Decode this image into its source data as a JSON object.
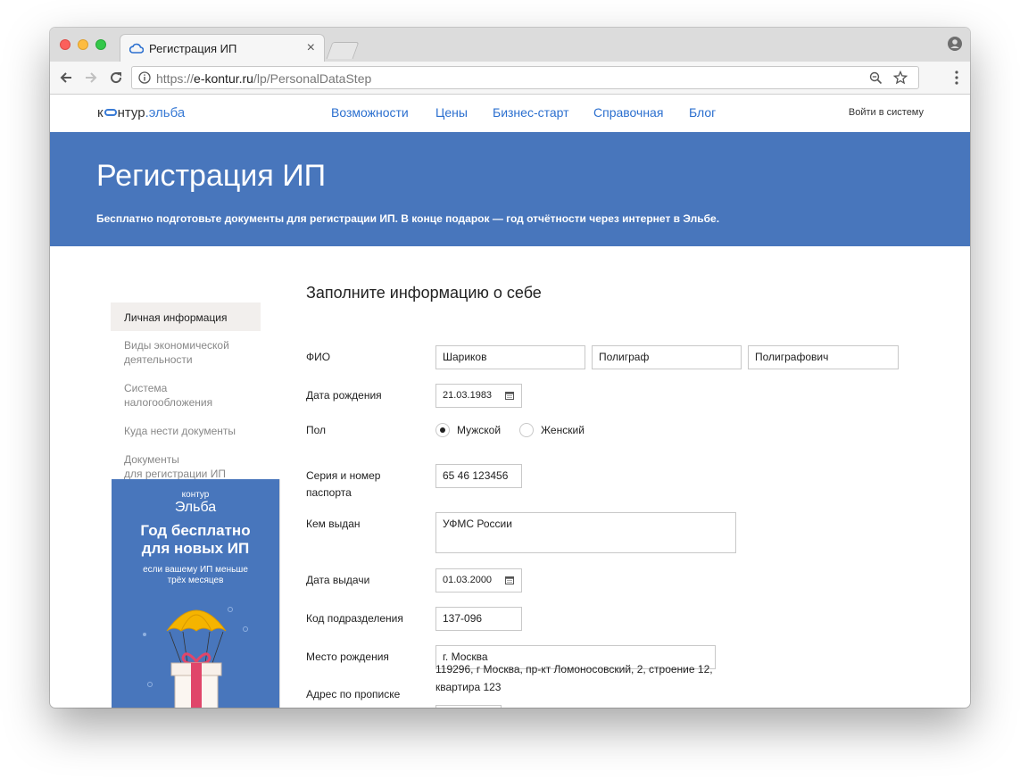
{
  "browser": {
    "tab_title": "Регистрация ИП",
    "tab_close": "×",
    "url_scheme": "https://",
    "url_host": "e-kontur.ru",
    "url_path": "/lp/PersonalDataStep"
  },
  "site": {
    "logo_prefix": "к",
    "logo_middle": "нтур",
    "logo_accent": ".эльба",
    "nav": [
      "Возможности",
      "Цены",
      "Бизнес-старт",
      "Справочная",
      "Блог"
    ],
    "login": "Войти в систему"
  },
  "hero": {
    "title": "Регистрация ИП",
    "subtitle": "Бесплатно подготовьте документы для регистрации ИП. В конце подарок — год отчётности через интернет в Эльбе."
  },
  "sidebar": {
    "items": [
      {
        "line1": "Личная информация",
        "line2": ""
      },
      {
        "line1": "Виды экономической",
        "line2": "деятельности"
      },
      {
        "line1": "Система",
        "line2": "налогообложения"
      },
      {
        "line1": "Куда нести документы",
        "line2": ""
      },
      {
        "line1": "Документы",
        "line2": "для регистрации ИП"
      }
    ],
    "active_index": 0
  },
  "promo": {
    "logo_top": "контур",
    "logo_bottom": "Эльба",
    "title_line1": "Год бесплатно",
    "title_line2": "для новых ИП",
    "sub_line1": "если вашему ИП меньше",
    "sub_line2": "трёх месяцев"
  },
  "form": {
    "title": "Заполните информацию о себе",
    "labels": {
      "fio": "ФИО",
      "birth_date": "Дата рождения",
      "gender": "Пол",
      "passport_line1": "Серия и номер",
      "passport_line2": "паспорта",
      "issued_by": "Кем выдан",
      "issue_date": "Дата выдачи",
      "division_code": "Код подразделения",
      "birth_place": "Место рождения",
      "address": "Адрес по прописке"
    },
    "values": {
      "last_name": "Шариков",
      "first_name": "Полиграф",
      "middle_name": "Полиграфович",
      "birth_date": "21.03.1983",
      "passport": "65 46 123456",
      "issued_by": "УФМС России",
      "issue_date": "01.03.2000",
      "division_code": "137-096",
      "birth_place": "г. Москва",
      "address": "119296, г Москва, пр-кт Ломоносовский, 2, строение 12, квартира 123"
    },
    "gender_options": [
      "Мужской",
      "Женский"
    ],
    "gender_selected": "Мужской"
  },
  "colors": {
    "hero_bg": "#4876bc",
    "link": "#2b6fcf",
    "sidebar_active_bg": "#f2efed"
  }
}
